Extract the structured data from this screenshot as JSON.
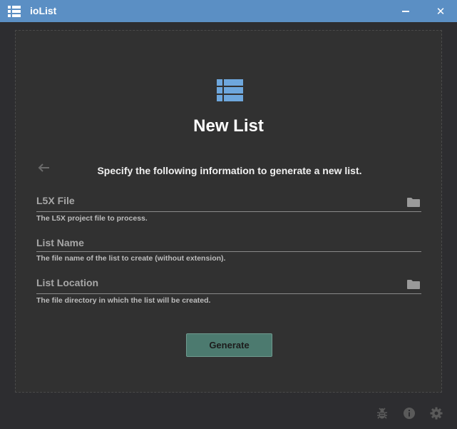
{
  "window": {
    "title": "ioList",
    "app_icon": "list-icon",
    "minimize_icon": "minimize-icon",
    "close_icon": "close-icon",
    "close_glyph": "✕"
  },
  "page": {
    "icon": "list-icon",
    "title": "New List",
    "back_icon": "arrow-left-icon",
    "instructions": "Specify the following information to generate a new list."
  },
  "fields": [
    {
      "label": "L5X File",
      "value": "",
      "help": "The L5X project file to process.",
      "icon": "folder-icon"
    },
    {
      "label": "List Name",
      "value": "",
      "help": "The file name of the list to create (without extension)."
    },
    {
      "label": "List Location",
      "value": "",
      "help": "The file directory in which the list will be created.",
      "icon": "folder-icon"
    }
  ],
  "actions": {
    "generate_label": "Generate"
  },
  "footer": {
    "icons": [
      "bug-icon",
      "info-icon",
      "gear-icon"
    ]
  },
  "colors": {
    "titlebar": "#5b8fc4",
    "background": "#2d2d30",
    "accent": "#6ea7dd",
    "button": "#4c7a6f"
  }
}
